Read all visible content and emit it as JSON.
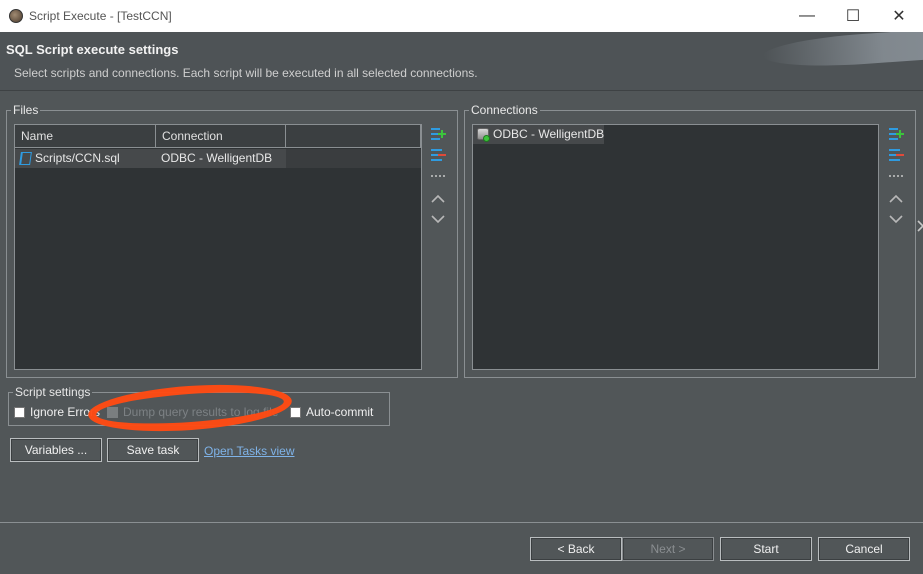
{
  "window": {
    "title": "Script Execute - [TestCCN]",
    "minimize": "—",
    "maximize": "☐",
    "close": "✕"
  },
  "header": {
    "title": "SQL Script execute settings",
    "description": "Select scripts and connections. Each script will be executed in all selected connections."
  },
  "files": {
    "label": "Files",
    "columns": [
      "Name",
      "Connection"
    ],
    "rows": [
      {
        "name": "Scripts/CCN.sql",
        "connection": "ODBC - WelligentDB"
      }
    ]
  },
  "connections": {
    "label": "Connections",
    "items": [
      {
        "name": "ODBC - WelligentDB"
      }
    ]
  },
  "toolbar_icons": [
    "add-icon",
    "remove-icon",
    "ellipsis-icon",
    "chevron-up-icon",
    "chevron-down-icon"
  ],
  "script_settings": {
    "label": "Script settings",
    "ignore_errors": {
      "label": "Ignore Errors",
      "checked": false
    },
    "dump_results": {
      "label": "Dump query results to log file",
      "checked": false,
      "enabled": false
    },
    "auto_commit": {
      "label": "Auto-commit",
      "checked": false
    }
  },
  "actions": {
    "variables": "Variables ...",
    "save_task": "Save task",
    "open_tasks_view": "Open Tasks view"
  },
  "footer": {
    "back": "< Back",
    "next": "Next >",
    "start": "Start",
    "cancel": "Cancel"
  },
  "colors": {
    "background": "#515658",
    "panel": "#2f3335",
    "link": "#7fb3e8",
    "annotation": "#ff4a13",
    "add_icon": "#2f9be0",
    "remove_icon": "#e04a3a"
  }
}
